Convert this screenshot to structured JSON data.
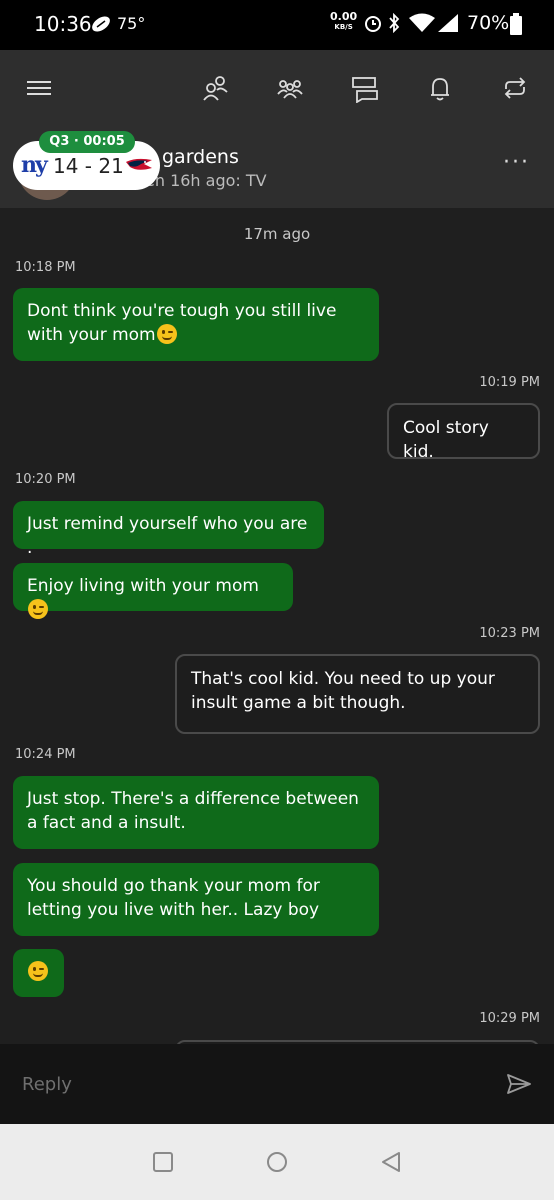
{
  "status_bar": {
    "time": "10:36",
    "temperature": "75°",
    "net_speed": "0.00",
    "net_unit": "KB/S",
    "battery": "70%"
  },
  "header": {
    "icons": [
      "menu-icon",
      "friends-icon",
      "party-icon",
      "messages-icon",
      "notifications-icon",
      "refresh-icon"
    ],
    "contact": {
      "name": "gardens",
      "status": "en 16h ago: TV"
    },
    "more": "···"
  },
  "score_overlay": {
    "period": "Q3 · 00:05",
    "team_left": "ny",
    "score": "14 - 21"
  },
  "chat": {
    "session_time": "17m ago",
    "messages": [
      {
        "time": "10:18 PM"
      },
      {
        "text": "Dont think you're tough you still live with your mom",
        "emoji": true
      },
      {
        "time": "10:19 PM"
      },
      {
        "text": "Cool story kid."
      },
      {
        "time": "10:20 PM"
      },
      {
        "text": "Just remind yourself who you are ."
      },
      {
        "text": "Enjoy living with your mom",
        "emoji": true
      },
      {
        "time": "10:23 PM"
      },
      {
        "text": "That's cool kid. You need to up your insult game a bit though."
      },
      {
        "time": "10:24 PM"
      },
      {
        "text": "Just stop. There's a difference between a fact and a insult."
      },
      {
        "text": "You should go thank your mom for letting you live with her.. Lazy boy"
      },
      {
        "emoji_only": true
      },
      {
        "time": "10:29 PM"
      }
    ]
  },
  "reply": {
    "placeholder": "Reply"
  },
  "colors": {
    "incoming_bubble": "#0f6a1a",
    "header_bg": "#2e2e2e",
    "chat_bg": "#1f1f1f",
    "score_pill": "#1e8e3e"
  }
}
